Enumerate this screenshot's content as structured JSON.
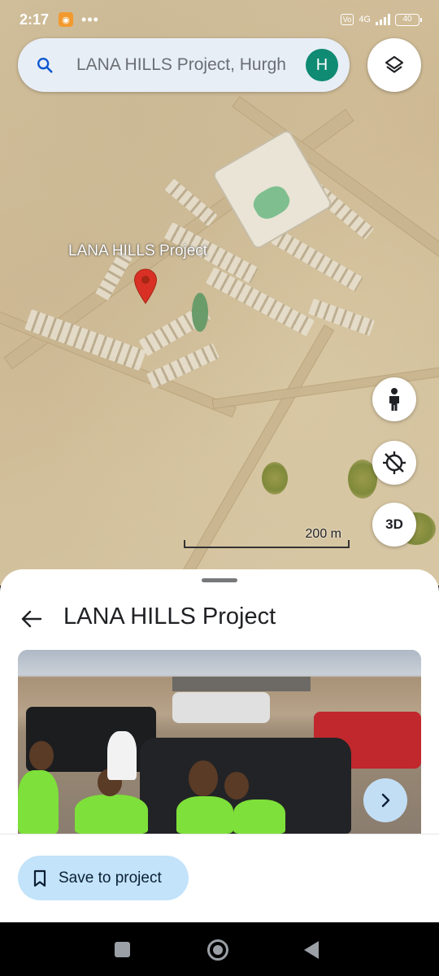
{
  "status_bar": {
    "time": "2:17",
    "app_badge": "●",
    "dots": "•••",
    "network": "4G",
    "volte": "Vo LTE",
    "battery": "40"
  },
  "search": {
    "query": "LANA HILLS Project, Hurgh",
    "avatar_letter": "H",
    "icon": "search-icon"
  },
  "map": {
    "place_label": "LANA HILLS Project",
    "scale_text": "200 m",
    "three_d_label": "3D",
    "icons": [
      "layers-icon",
      "pegman-icon",
      "location-off-icon",
      "map-pin-icon"
    ]
  },
  "sheet": {
    "title": "LANA HILLS Project",
    "save_label": "Save to project",
    "icons": [
      "back-arrow-icon",
      "bookmark-icon",
      "chevron-right-icon"
    ]
  },
  "colors": {
    "accent": "#0b57d0",
    "avatar_bg": "#0f8a73",
    "save_bg": "#c2e3fa",
    "pin": "#d93025"
  }
}
